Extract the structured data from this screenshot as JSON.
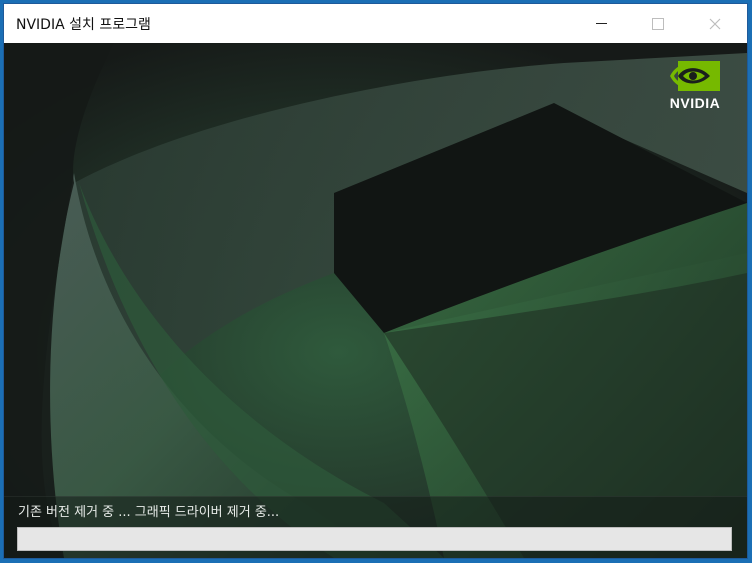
{
  "window": {
    "title": "NVIDIA 설치 프로그램",
    "controls": {
      "minimize": "minimize",
      "maximize": "maximize",
      "close": "close"
    }
  },
  "logo": {
    "text": "NVIDIA",
    "icon": "nvidia-eye-logo",
    "color": "#76b900"
  },
  "status": {
    "message": "기존 버전 제거 중 ... 그래픽 드라이버 제거 중...",
    "progress": 0
  },
  "colors": {
    "accent": "#76b900",
    "background": "#1a1f1c",
    "window_border": "#1b6fb5"
  }
}
